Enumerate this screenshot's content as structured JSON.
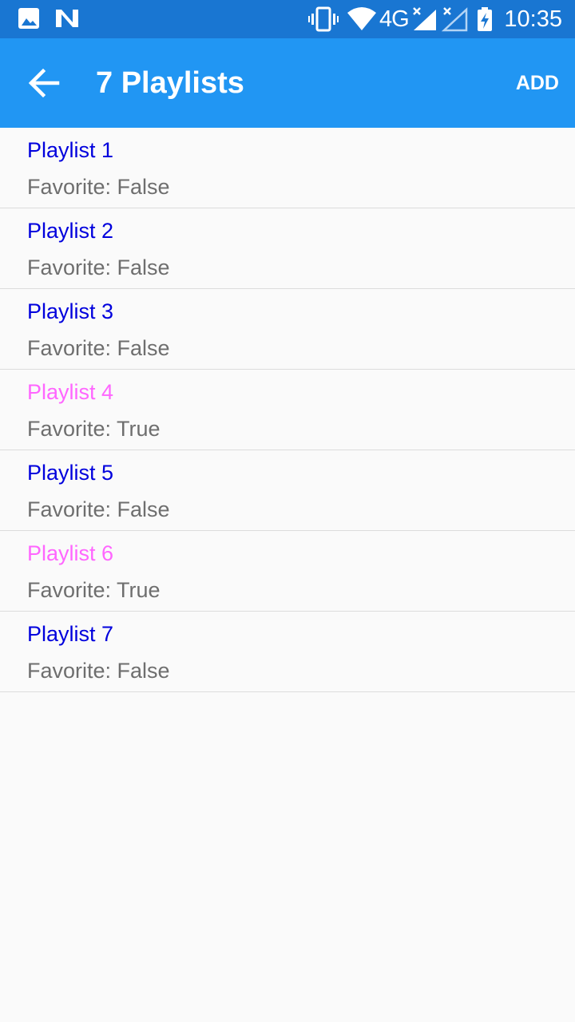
{
  "status_bar": {
    "time": "10:35",
    "network": "4G",
    "icons": [
      "image-icon",
      "n-notification-icon",
      "vibrate-icon",
      "wifi-icon",
      "cellular-signal-icon",
      "no-signal-icon",
      "battery-charging-icon"
    ]
  },
  "app_bar": {
    "back_icon": "arrow-back-icon",
    "title": "7 Playlists",
    "add_label": "ADD"
  },
  "colors": {
    "status_bar": "#1976d2",
    "app_bar": "#2196f3",
    "name_default": "#0000dd",
    "name_favorite": "#ff66ff",
    "secondary_text": "#6e6e6e",
    "background": "#fafafa"
  },
  "playlists": [
    {
      "name": "Playlist 1",
      "favorite": "Favorite: False",
      "is_favorite": false
    },
    {
      "name": "Playlist 2",
      "favorite": "Favorite: False",
      "is_favorite": false
    },
    {
      "name": "Playlist 3",
      "favorite": "Favorite: False",
      "is_favorite": false
    },
    {
      "name": "Playlist 4",
      "favorite": "Favorite: True",
      "is_favorite": true
    },
    {
      "name": "Playlist 5",
      "favorite": "Favorite: False",
      "is_favorite": false
    },
    {
      "name": "Playlist 6",
      "favorite": "Favorite: True",
      "is_favorite": true
    },
    {
      "name": "Playlist 7",
      "favorite": "Favorite: False",
      "is_favorite": false
    }
  ]
}
